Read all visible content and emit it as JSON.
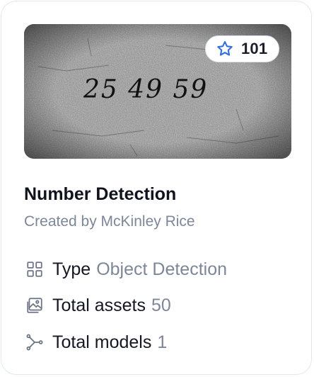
{
  "card": {
    "title": "Number Detection",
    "creator": "Created by McKinley Rice",
    "stars": {
      "count": "101",
      "icon": "star-icon",
      "icon_color": "#2e6fe0"
    },
    "image": {
      "handwritten_text": "25 49 59"
    },
    "meta": {
      "type": {
        "label": "Type",
        "value": "Object Detection",
        "icon": "grid-icon"
      },
      "assets": {
        "label": "Total assets",
        "value": "50",
        "icon": "image-icon"
      },
      "models": {
        "label": "Total models",
        "value": "1",
        "icon": "branch-icon"
      }
    }
  }
}
